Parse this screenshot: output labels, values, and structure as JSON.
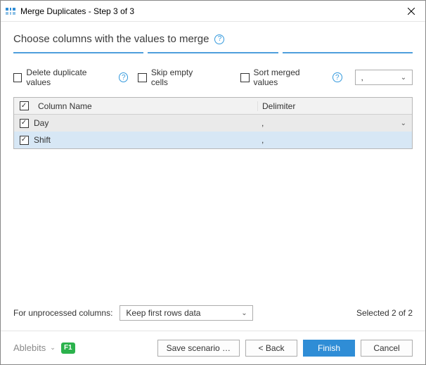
{
  "window": {
    "title": "Merge Duplicates - Step 3 of 3"
  },
  "heading": "Choose columns with the values to merge",
  "options": {
    "delete_dup": "Delete duplicate values",
    "skip_empty": "Skip empty cells",
    "sort_merged": "Sort merged values",
    "sort_combo_value": ","
  },
  "table": {
    "header_name": "Column Name",
    "header_delim": "Delimiter",
    "rows": [
      {
        "name": "Day",
        "delimiter": ",",
        "checked": true,
        "active": true
      },
      {
        "name": "Shift",
        "delimiter": ",",
        "checked": true,
        "active": false
      }
    ]
  },
  "unprocessed": {
    "label": "For unprocessed columns:",
    "value": "Keep first rows data"
  },
  "selected_text": "Selected 2 of 2",
  "footer": {
    "brand": "Ablebits",
    "f1": "F1",
    "save": "Save scenario …",
    "back": "<  Back",
    "finish": "Finish",
    "cancel": "Cancel"
  }
}
